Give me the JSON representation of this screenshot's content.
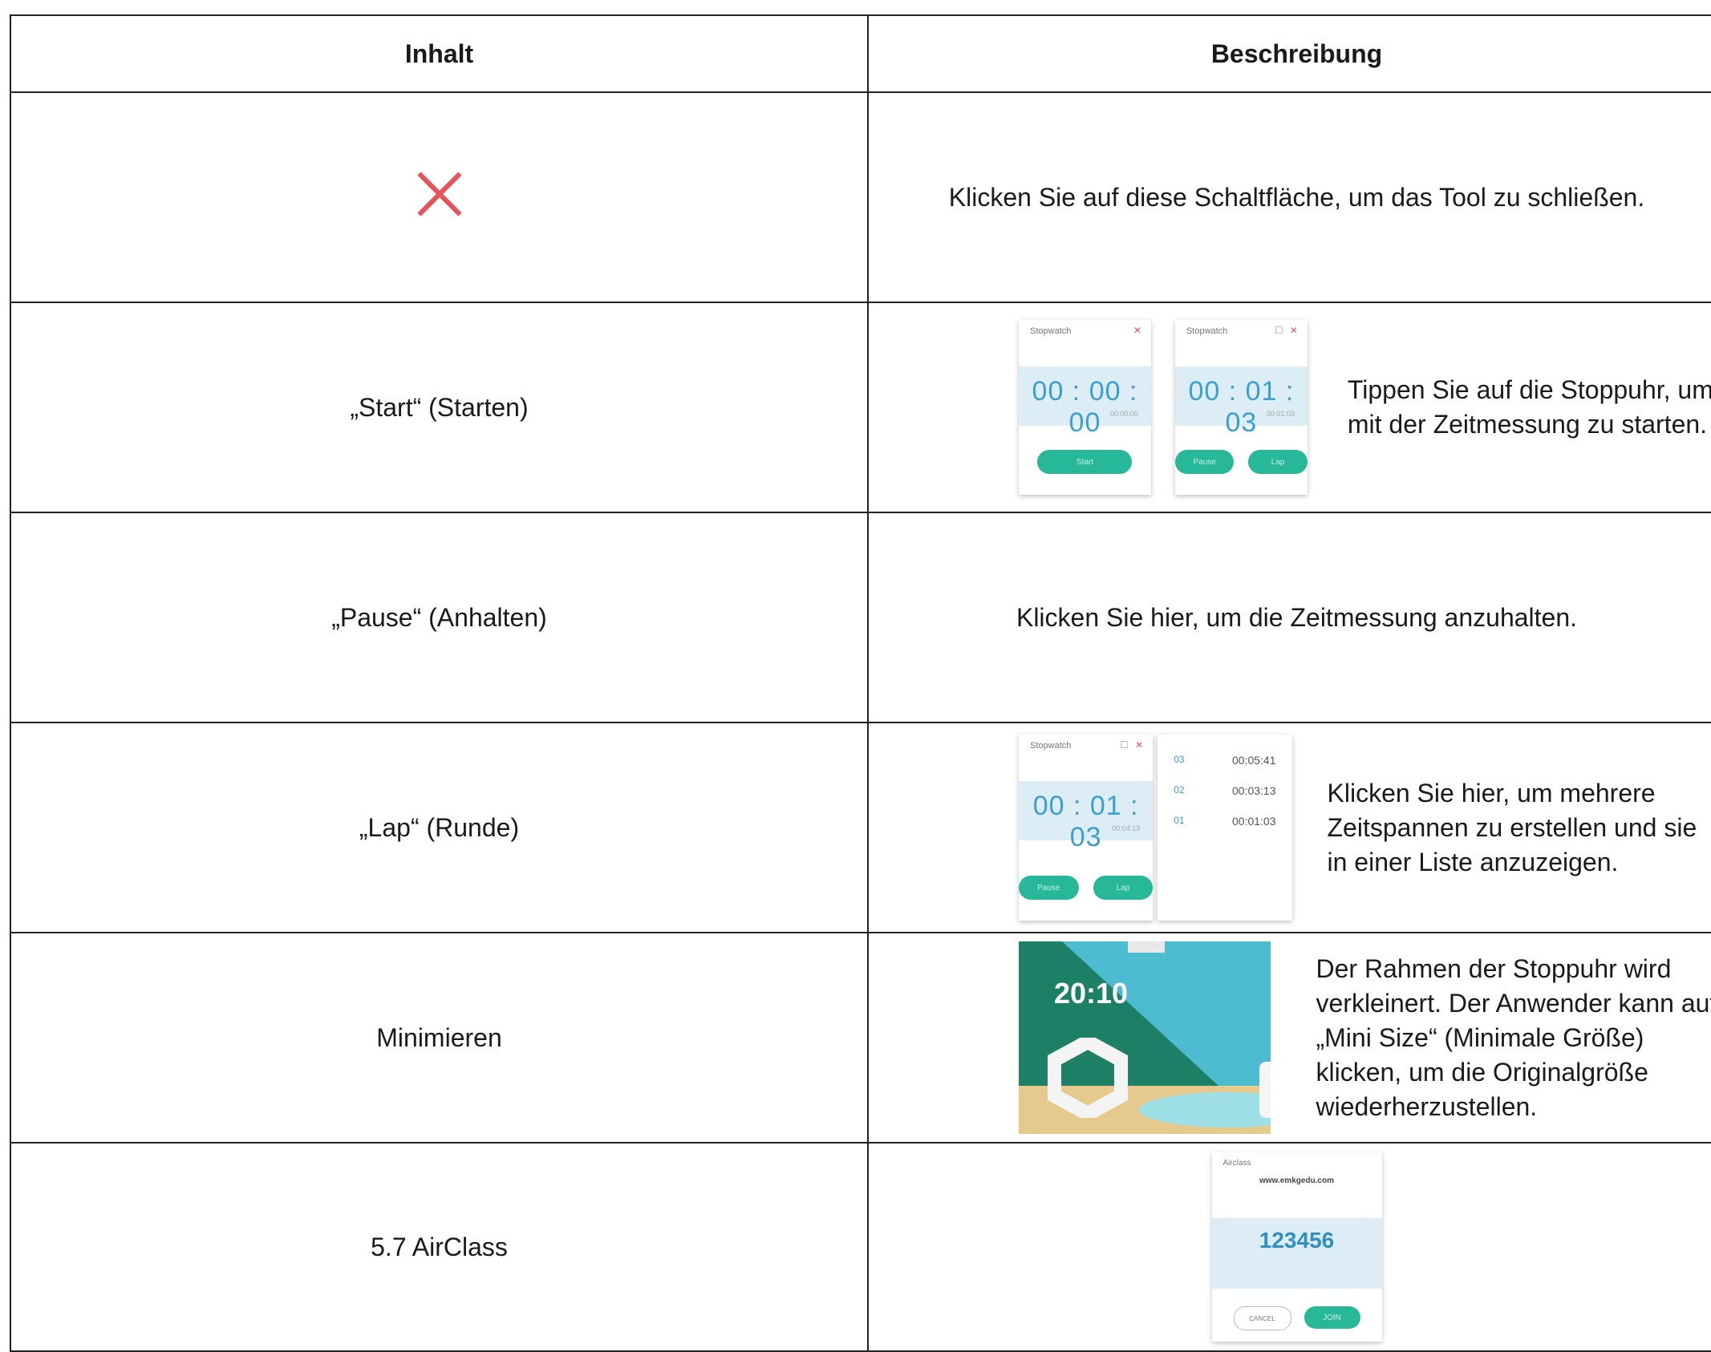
{
  "header": {
    "col1": "Inhalt",
    "col2": "Beschreibung"
  },
  "rows": [
    {
      "content": "",
      "icon": "close-icon",
      "description": "Klicken Sie auf diese Schaltfläche, um das Tool zu schließen."
    },
    {
      "content": "„Start“ (Starten)",
      "description": "Tippen Sie auf die Stoppuhr, um mit der Zeitmessung zu starten."
    },
    {
      "content": "„Pause“ (Anhalten)",
      "description": "Klicken Sie hier, um die Zeitmessung anzuhalten."
    },
    {
      "content": "„Lap“ (Runde)",
      "description": "Klicken Sie hier, um mehrere Zeitspannen zu erstellen und sie in einer Liste anzuzeigen."
    },
    {
      "content": "Minimieren",
      "description": "Der Rahmen der Stoppuhr wird verkleinert. Der Anwender kann auf „Mini Size“ (Minimale Größe) klicken, um die Originalgröße wiederherzustellen."
    },
    {
      "content": "5.7 AirClass",
      "description": ""
    }
  ],
  "stopwatch_a": {
    "title": "Stopwatch",
    "time": "00 : 00 : 00",
    "sub": "00:00:00",
    "button": "Start"
  },
  "stopwatch_b": {
    "title": "Stopwatch",
    "time": "00 : 01 : 03",
    "sub": "00:01:03",
    "button1": "Pause",
    "button2": "Lap"
  },
  "stopwatch_c": {
    "title": "Stopwatch",
    "time": "00 : 01 : 03",
    "sub": "00:04:13",
    "button1": "Pause",
    "button2": "Lap"
  },
  "laps": [
    {
      "n": "03",
      "t": "00:05:41"
    },
    {
      "n": "02",
      "t": "00:03:13"
    },
    {
      "n": "01",
      "t": "00:01:03"
    }
  ],
  "mini_scene": {
    "clock": "20:10"
  },
  "airclass": {
    "title": "Airclass",
    "url": "www.emkgedu.com",
    "code": "123456",
    "cancel": "CANCEL",
    "join": "JOIN"
  },
  "colors": {
    "accent": "#27b89a",
    "time_blue": "#3aa0cf",
    "close_red": "#e8525a"
  }
}
